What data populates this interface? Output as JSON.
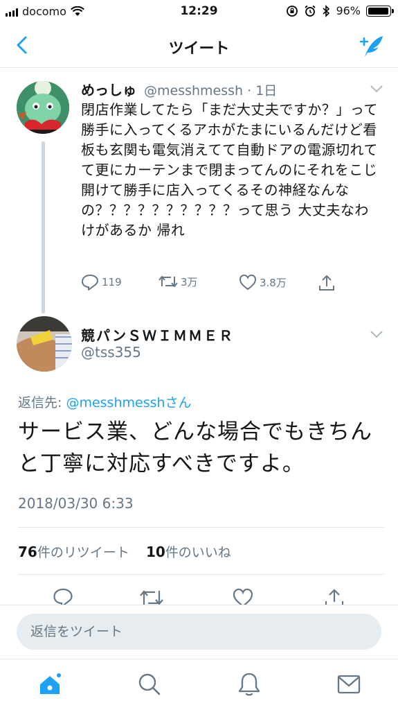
{
  "status_bar": {
    "carrier": "docomo",
    "time": "12:29",
    "battery": "96%",
    "battery_level": 0.96
  },
  "nav": {
    "title": "ツイート"
  },
  "parent_tweet": {
    "name": "めっしゅ",
    "handle": "@messhmessh · 1日",
    "text": "閉店作業してたら「まだ大丈夫ですか？」って勝手に入ってくるアホがたまにいるんだけど看板も玄関も電気消えてて自動ドアの電源切れてて更にカーテンまで閉まってんのにそれをこじ開けて勝手に店入ってくるその神経なんなの？？？？？？？？？？って思う 大丈夫なわけがあるか 帰れ",
    "replies": "119",
    "retweets": "3万",
    "likes": "3.8万"
  },
  "reply_tweet": {
    "name": "競パンＳＷＩＭＭＥＲ",
    "handle": "@tss355",
    "reply_to_prefix": "返信先: ",
    "reply_to_mention": "@messhmesshさん",
    "text": "サービス業、どんな場合でもきちんと丁寧に対応すべきですよ。",
    "timestamp": "2018/03/30 6:33",
    "retweet_count": "76",
    "retweet_label": "件のリツイート",
    "like_count": "10",
    "like_label": "件のいいね"
  },
  "reply_box": {
    "placeholder": "返信をツイート"
  },
  "icons": {
    "back": "chevron-left-icon",
    "compose": "compose-tweet-icon",
    "reply": "reply-icon",
    "retweet": "retweet-icon",
    "like": "heart-icon",
    "share": "share-icon",
    "home": "home-icon",
    "search": "search-icon",
    "notifications": "bell-icon",
    "messages": "mail-icon"
  },
  "colors": {
    "accent": "#1da1f2",
    "secondary_text": "#657786",
    "divider": "#e1e8ed"
  }
}
